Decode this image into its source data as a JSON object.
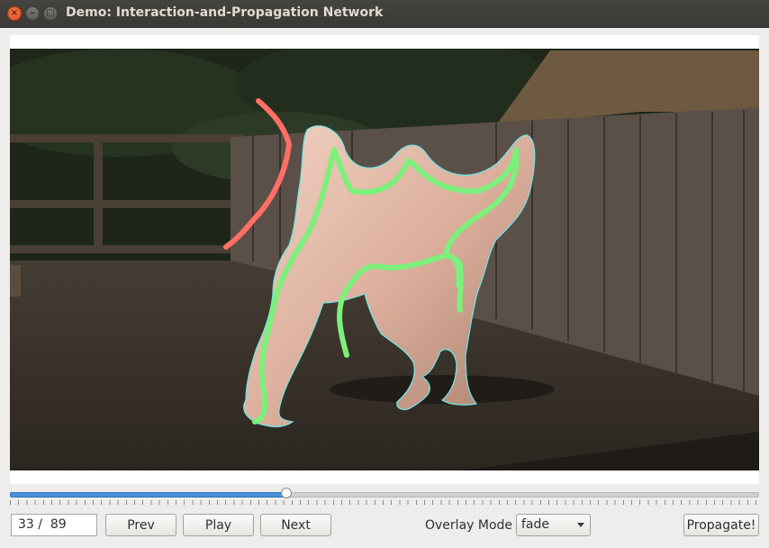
{
  "window": {
    "title": "Demo: Interaction-and-Propagation Network",
    "close_glyph": "×",
    "minimize_glyph": "–",
    "maximize_glyph": "□"
  },
  "image": {
    "subject": "camel-video-frame",
    "overlay_colors": {
      "positive_scribble": "#7cf07a",
      "negative_scribble": "#ff6f66",
      "mask_outline": "#6fe6e6"
    }
  },
  "playback": {
    "current_frame": 33,
    "total_frames": 89,
    "frame_display": "33 /  89",
    "slider_fraction": 0.37
  },
  "controls": {
    "prev_label": "Prev",
    "play_label": "Play",
    "next_label": "Next",
    "overlay_mode_label": "Overlay Mode",
    "overlay_mode_value": "fade",
    "propagate_label": "Propagate!"
  },
  "colors": {
    "slider_fill": "#4a90d9",
    "titlebar": "#3c3b37",
    "close_button": "#e9541e"
  }
}
